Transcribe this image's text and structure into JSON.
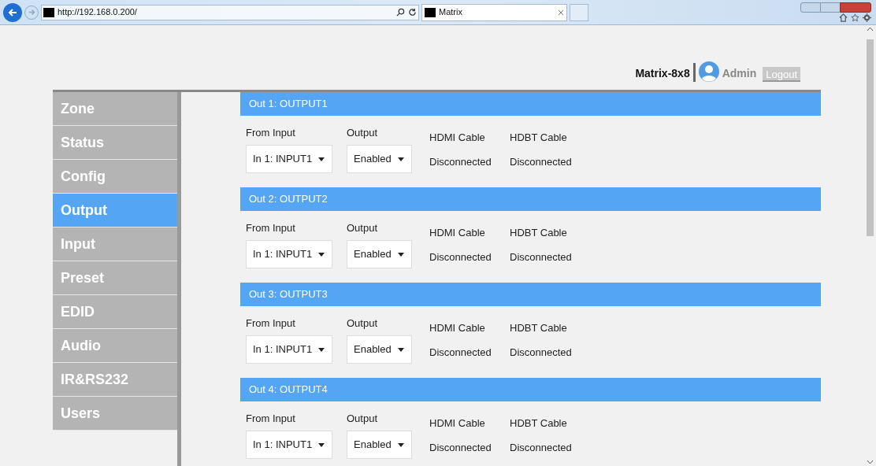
{
  "browser": {
    "url": "http://192.168.0.200/",
    "tab_title": "Matrix"
  },
  "header": {
    "device": "Matrix-8x8",
    "user": "Admin",
    "logout": "Logout"
  },
  "sidebar": {
    "items": [
      {
        "label": "Zone",
        "selected": false
      },
      {
        "label": "Status",
        "selected": false
      },
      {
        "label": "Config",
        "selected": false
      },
      {
        "label": "Output",
        "selected": true
      },
      {
        "label": "Input",
        "selected": false
      },
      {
        "label": "Preset",
        "selected": false
      },
      {
        "label": "EDID",
        "selected": false
      },
      {
        "label": "Audio",
        "selected": false
      },
      {
        "label": "IR&RS232",
        "selected": false
      },
      {
        "label": "Users",
        "selected": false
      }
    ]
  },
  "outputs": [
    {
      "title": "Out 1: OUTPUT1",
      "from_input_label": "From Input",
      "from_input_value": "In 1: INPUT1",
      "output_label": "Output",
      "output_value": "Enabled",
      "hdmi_label": "HDMI Cable",
      "hdmi_status": "Disconnected",
      "hdbt_label": "HDBT Cable",
      "hdbt_status": "Disconnected"
    },
    {
      "title": "Out 2: OUTPUT2",
      "from_input_label": "From Input",
      "from_input_value": "In 1: INPUT1",
      "output_label": "Output",
      "output_value": "Enabled",
      "hdmi_label": "HDMI Cable",
      "hdmi_status": "Disconnected",
      "hdbt_label": "HDBT Cable",
      "hdbt_status": "Disconnected"
    },
    {
      "title": "Out 3: OUTPUT3",
      "from_input_label": "From Input",
      "from_input_value": "In 1: INPUT1",
      "output_label": "Output",
      "output_value": "Enabled",
      "hdmi_label": "HDMI Cable",
      "hdmi_status": "Disconnected",
      "hdbt_label": "HDBT Cable",
      "hdbt_status": "Disconnected"
    },
    {
      "title": "Out 4: OUTPUT4",
      "from_input_label": "From Input",
      "from_input_value": "In 1: INPUT1",
      "output_label": "Output",
      "output_value": "Enabled",
      "hdmi_label": "HDMI Cable",
      "hdmi_status": "Disconnected",
      "hdbt_label": "HDBT Cable",
      "hdbt_status": "Disconnected"
    }
  ]
}
